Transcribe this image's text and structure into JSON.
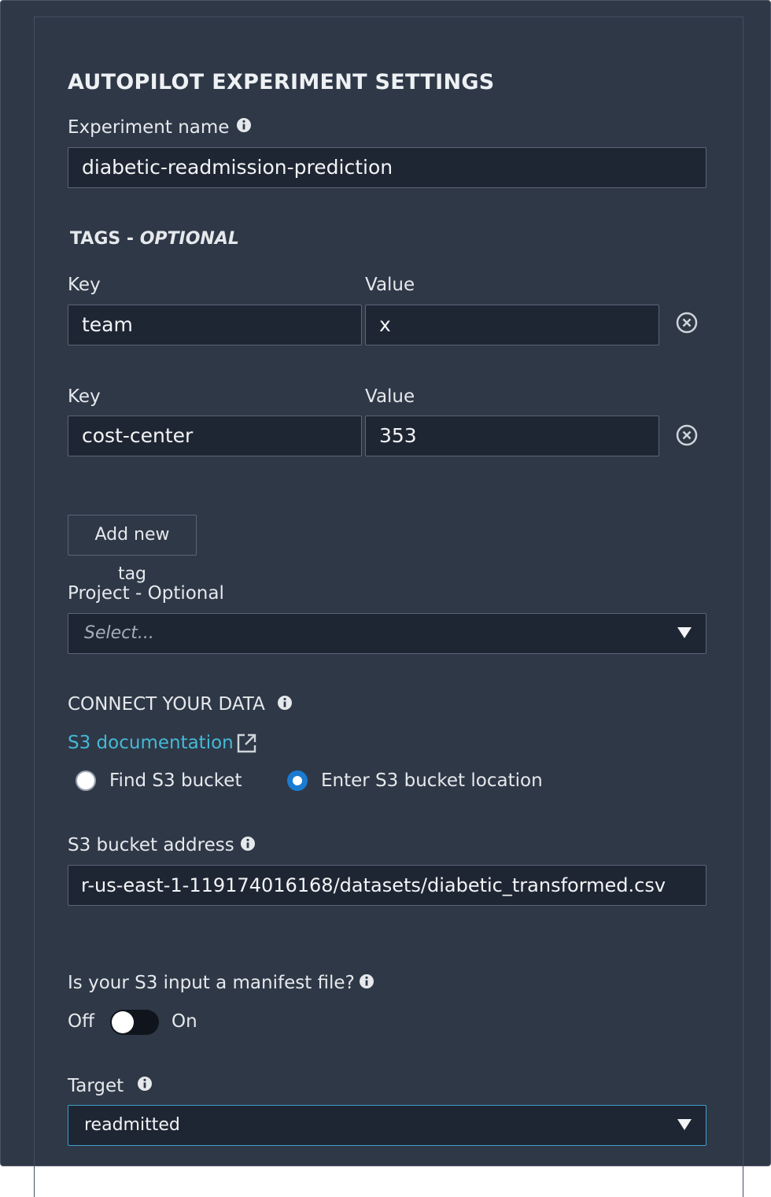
{
  "section_title": "AUTOPILOT EXPERIMENT SETTINGS",
  "experiment": {
    "label": "Experiment name",
    "value": "diabetic-readmission-prediction"
  },
  "tags": {
    "title_prefix": "TAGS - ",
    "title_optional": "OPTIONAL",
    "rows": [
      {
        "key_label": "Key",
        "value_label": "Value",
        "key": "team",
        "value": "x"
      },
      {
        "key_label": "Key",
        "value_label": "Value",
        "key": "cost-center",
        "value": "353"
      }
    ],
    "add_button": "Add new tag"
  },
  "project": {
    "label": "Project - Optional",
    "placeholder": "Select..."
  },
  "connect": {
    "title": "CONNECT YOUR DATA",
    "doc_link": "S3 documentation",
    "radio_find": "Find S3 bucket",
    "radio_enter": "Enter S3 bucket location",
    "selected": "Enter S3 bucket location"
  },
  "bucket": {
    "label": "S3 bucket address",
    "value": "r-us-east-1-119174016168/datasets/diabetic_transformed.csv"
  },
  "manifest": {
    "label": "Is your S3 input a manifest file?",
    "off_label": "Off",
    "on_label": "On",
    "state": "off"
  },
  "target": {
    "label": "Target",
    "value": "readmitted"
  },
  "colors": {
    "background": "#2f3847",
    "input_background": "#1f2633",
    "link": "#44b9d6",
    "radio_selected": "#1a7bd1"
  }
}
